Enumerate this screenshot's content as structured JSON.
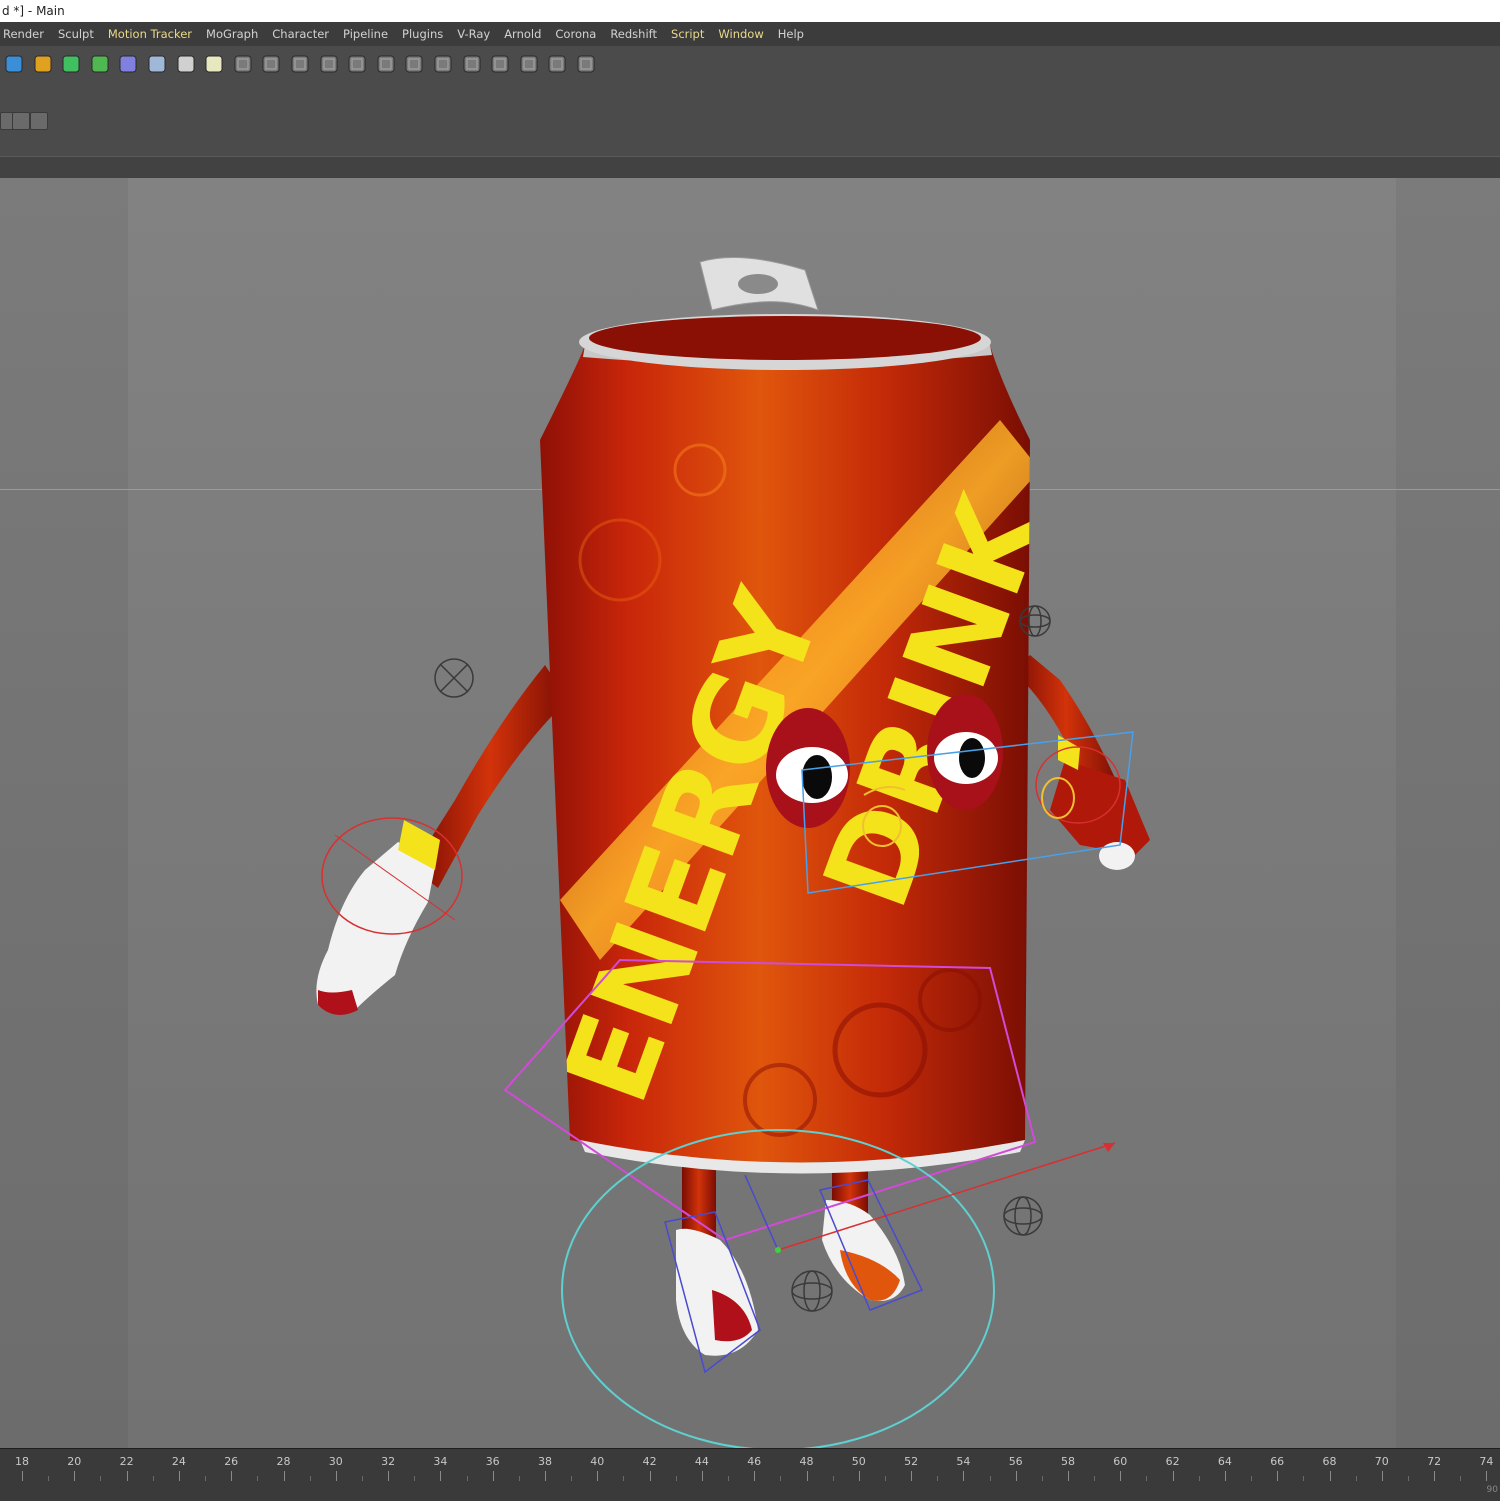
{
  "window": {
    "title": "d *] - Main"
  },
  "menu": [
    {
      "label": "Render",
      "highlight": false
    },
    {
      "label": "Sculpt",
      "highlight": false
    },
    {
      "label": "Motion Tracker",
      "highlight": true
    },
    {
      "label": "MoGraph",
      "highlight": false
    },
    {
      "label": "Character",
      "highlight": false
    },
    {
      "label": "Pipeline",
      "highlight": false
    },
    {
      "label": "Plugins",
      "highlight": false
    },
    {
      "label": "V-Ray",
      "highlight": false
    },
    {
      "label": "Arnold",
      "highlight": false
    },
    {
      "label": "Corona",
      "highlight": false
    },
    {
      "label": "Redshift",
      "highlight": false
    },
    {
      "label": "Script",
      "highlight": true
    },
    {
      "label": "Window",
      "highlight": true
    },
    {
      "label": "Help",
      "highlight": false
    }
  ],
  "toolbar": {
    "icons": [
      "cube-icon",
      "pen-icon",
      "subdivision-icon",
      "cloner-icon",
      "deformer-icon",
      "floor-icon",
      "camera-icon",
      "light-icon",
      "bone-icon",
      "joint-icon",
      "ik-icon",
      "skin-icon",
      "weight-icon",
      "constraint-icon",
      "cloth-icon",
      "rope-icon",
      "spline-icon",
      "mesh-icon",
      "grid-icon",
      "array-icon",
      "matrix-icon"
    ]
  },
  "viewport": {
    "scene": "Energy can character rig",
    "can_text": [
      "ENERGY",
      "DRINK"
    ]
  },
  "timeline": {
    "ticks": [
      "18",
      "20",
      "22",
      "24",
      "26",
      "28",
      "30",
      "32",
      "34",
      "36",
      "38",
      "40",
      "42",
      "44",
      "46",
      "48",
      "50",
      "52",
      "54",
      "56",
      "58",
      "60",
      "62",
      "64",
      "66",
      "68",
      "70",
      "72",
      "74"
    ],
    "end_label": "90"
  },
  "colors": {
    "accent_menu": "#e8d98a",
    "viewport": "#7a7a7a",
    "can_red": "#c2220a",
    "can_yellow": "#f4e21a"
  }
}
